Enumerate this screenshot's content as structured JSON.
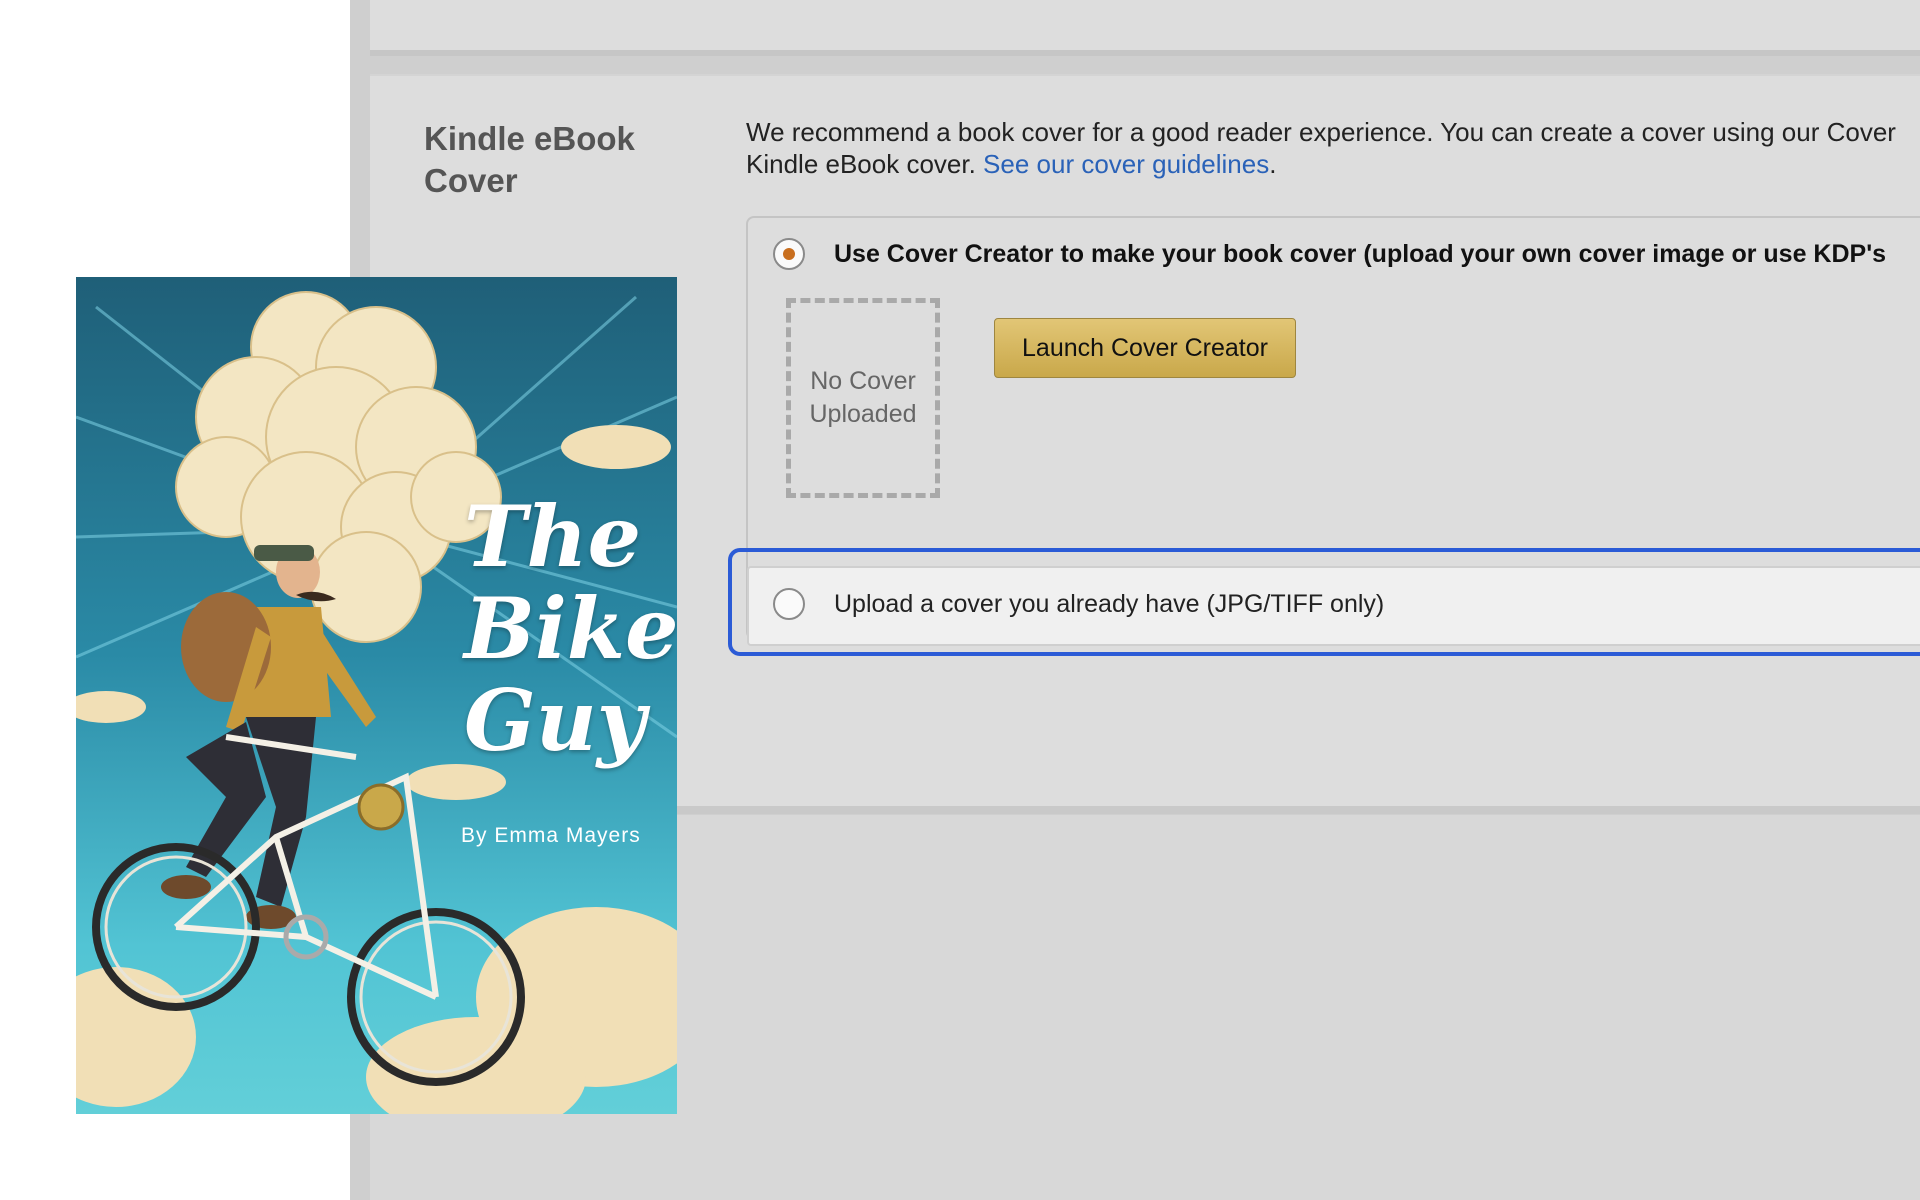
{
  "section": {
    "title": "Kindle eBook Cover",
    "intro_line1": "We recommend a book cover for a good reader experience. You can create a cover using our Cover",
    "intro_line2_prefix": "Kindle eBook cover. ",
    "intro_link": "See our cover guidelines",
    "intro_line2_suffix": "."
  },
  "options": {
    "cover_creator": {
      "label": "Use Cover Creator to make your book cover (upload your own cover image or use KDP's",
      "selected": true,
      "placeholder": "No Cover Uploaded",
      "button": "Launch Cover Creator"
    },
    "upload": {
      "label": "Upload a cover you already have (JPG/TIFF only)",
      "selected": false
    }
  },
  "book": {
    "title_line1": "The",
    "title_line2": "Bike",
    "title_line3": "Guy",
    "author": "By Emma Mayers"
  },
  "colors": {
    "radio_selected": "#c86e1e",
    "focus_outline": "#2b5bd6",
    "link": "#2a62b8",
    "button": "#d8b960"
  }
}
